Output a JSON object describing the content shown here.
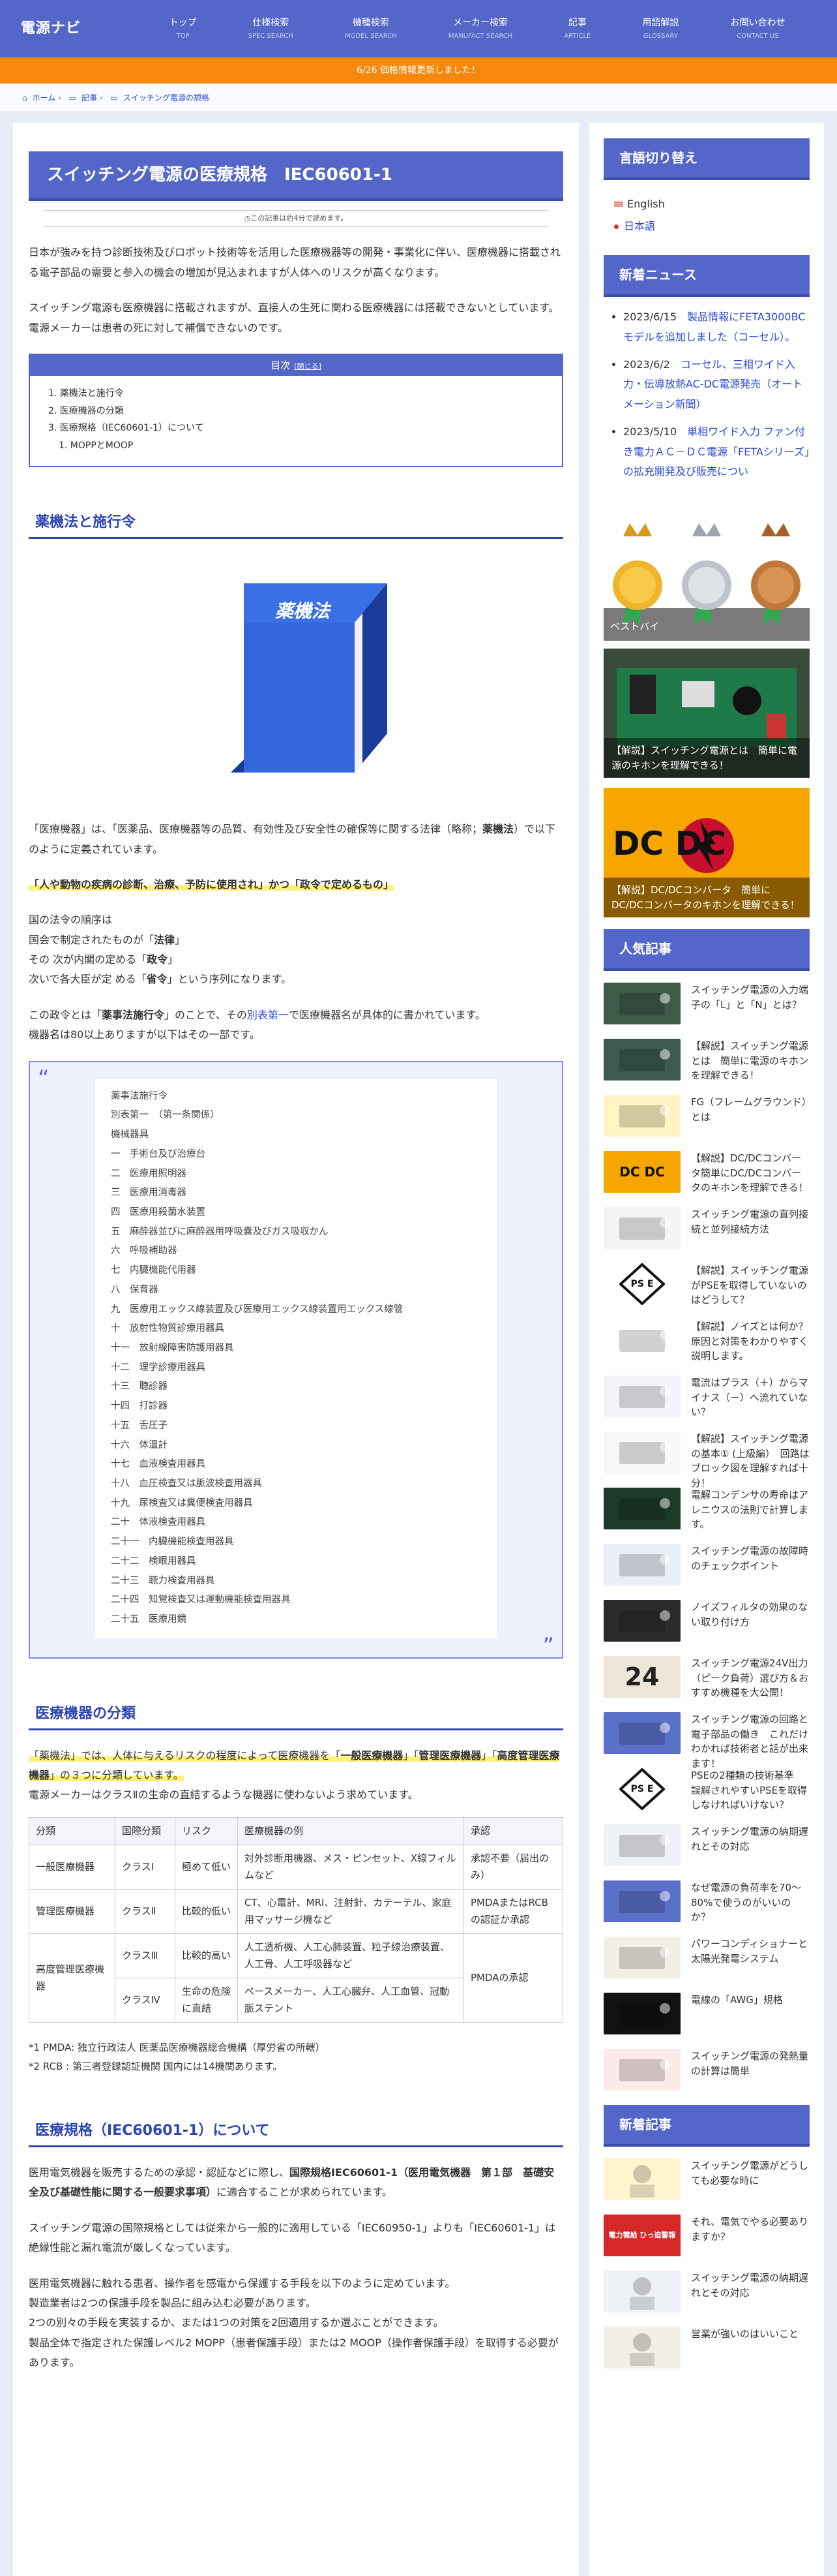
{
  "site": {
    "logo": "電源ナビ"
  },
  "nav": [
    {
      "ja": "トップ",
      "en": "TOP"
    },
    {
      "ja": "仕様検索",
      "en": "SPEC SEARCH"
    },
    {
      "ja": "機種検索",
      "en": "MODEL SEARCH"
    },
    {
      "ja": "メーカー検索",
      "en": "MANUFACT SEARCH"
    },
    {
      "ja": "記事",
      "en": "ARTICLE"
    },
    {
      "ja": "用語解説",
      "en": "GLOSSARY"
    },
    {
      "ja": "お問い合わせ",
      "en": "CONTACT US"
    }
  ],
  "notice": "6/26 価格情報更新しました！",
  "breadcrumb": [
    "ホーム",
    "記事",
    "スイッチング電源の規格"
  ],
  "article": {
    "title": "スイッチング電源の医療規格　IEC60601-1",
    "readtime": "この記事は約4分で読めます。",
    "intro1": "日本が強みを持つ診断技術及びロボット技術等を活用した医療機器等の開発・事業化に伴い、医療機器に搭載される電子部品の需要と参入の機会の増加が見込まれますが人体へのリスクが高くなります。",
    "intro2": "スイッチング電源も医療機器に搭載されますが、直接人の生死に関わる医療機器には搭載できないとしています。電源メーカーは患者の死に対して補償できないのです。",
    "toc": {
      "title": "目次",
      "toggle": "[閉じる]",
      "items": [
        "1. 薬機法と施行令",
        "2. 医療機器の分類",
        "3. 医療規格（IEC60601-1）について"
      ],
      "sub": "1. MOPPとMOOP"
    },
    "h2_1": "薬機法と施行令",
    "book_label": "薬機法",
    "p_def_a": "「医療機器」は、「医薬品、医療機器等の品質、有効性及び安全性の確保等に関する法律（略称；",
    "p_def_b": "薬機法",
    "p_def_c": "）で以下のように定義されています。",
    "p_hl": "「人や動物の疾病の診断、治療、予防に使用され」かつ「政令で定めるもの」",
    "order_0": "国の法令の順序は",
    "order_1a": "国会で制定されたものが「",
    "order_1b": "法律",
    "order_1c": "」",
    "order_2a": "その 次が内閣の定める「",
    "order_2b": "政令",
    "order_2c": "」",
    "order_3a": "次いで各大臣が定 める「",
    "order_3b": "省令",
    "order_3c": "」という序列になります。",
    "p_cab_a": "この政令とは「",
    "p_cab_b": "薬事法施行令",
    "p_cab_c": "」のことで、その",
    "p_cab_link": "別表第一",
    "p_cab_d": "で医療機器名が具体的に書かれています。",
    "p_cab_e": "機器名は80以上ありますが以下はその一部です。",
    "quote": [
      "薬事法施行令",
      "別表第一　（第一条関係）",
      "機械器具",
      "一　手術台及び治療台",
      "二　医療用照明器",
      "三　医療用消毒器",
      "四　医療用殺菌水装置",
      "五　麻酔器並びに麻酔器用呼吸嚢及びガス吸収かん",
      "六　呼吸補助器",
      "七　内臓機能代用器",
      "八　保育器",
      "九　医療用エックス線装置及び医療用エックス線装置用エックス線管",
      "十　放射性物質診療用器具",
      "十一　放射線障害防護用器具",
      "十二　理学診療用器具",
      "十三　聴診器",
      "十四　打診器",
      "十五　舌圧子",
      "十六　体温計",
      "十七　血液検査用器具",
      "十八　血圧検査又は脈波検査用器具",
      "十九　尿検査又は糞便検査用器具",
      "二十　体液検査用器具",
      "二十一　内臓機能検査用器具",
      "二十二　検眼用器具",
      "二十三　聴力検査用器具",
      "二十四　知覚検査又は運動機能検査用器具",
      "二十五　医療用鏡"
    ],
    "h2_2": "医療機器の分類",
    "cls_a": "「薬機法」では、人体に与えるリスクの程度によって医療機器を「",
    "cls_b": "一般医療機器",
    "cls_c": "」「",
    "cls_d": "管理医療機器",
    "cls_e": "」「",
    "cls_f": "高度管理医療機器",
    "cls_g": "」の３つに分類しています。",
    "cls_2": "電源メーカーはクラスⅡの生命の直結するような機器に使わないよう求めています。",
    "table": {
      "headers": [
        "分類",
        "国際分類",
        "リスク",
        "医療機器の例",
        "承認"
      ],
      "r1": [
        "一般医療機器",
        "クラスⅠ",
        "極めて低い",
        "対外診断用機器、メス・ピンセット、X線フィルムなど",
        "承認不要（届出のみ）"
      ],
      "r2": [
        "管理医療機器",
        "クラスⅡ",
        "比較的低い",
        "CT、心電計、MRI、注射針、カテーテル、家庭用マッサージ機など",
        "PMDAまたはRCBの認証か承認"
      ],
      "r3a": [
        "高度管理医療機器",
        "クラスⅢ",
        "比較的高い",
        "人工透析機、人工心肺装置、粒子線治療装置、人工骨、人工呼吸器など",
        "PMDAの承認"
      ],
      "r3b": [
        "クラスⅣ",
        "生命の危険に直結",
        "ペースメーカー、人工心臓弁、人工血管、冠動脈ステント"
      ]
    },
    "note1": "*1 PMDA: 独立行政法人 医薬品医療機器総合機構（厚労省の所轄）",
    "note2": "*2 RCB : 第三者登録認証機関 国内には14機関あります。",
    "h2_3": "医療規格（IEC60601-1）について",
    "iec_a": "医用電気機器を販売するための承認・認証などに際し、",
    "iec_b": "国際規格IEC60601-1（医用電気機器　第１部　基礎安全及び基礎性能に関する一般要求事項）",
    "iec_c": "に適合することが求められています。",
    "iec_2": "スイッチング電源の国際規格としては従来から一般的に適用している「IEC60950-1」よりも「IEC60601-1」は絶縁性能と漏れ電流が厳しくなっています。",
    "iec_3": [
      "医用電気機器に触れる患者、操作者を感電から保護する手段を以下のように定めています。",
      "製造業者は2つの保護手段を製品に組み込む必要があります。",
      "2つの別々の手段を実装するか、または1つの対策を2回適用するか選ぶことができます。",
      "製品全体で指定された保護レベル2 MOPP（患者保護手段）または2 MOOP（操作者保護手段）を取得する必要があります。"
    ]
  },
  "sidebar": {
    "lang_title": "言語切り替え",
    "langs": [
      "English",
      "日本語"
    ],
    "news_title": "新着ニュース",
    "news": [
      {
        "date": "2023/6/15",
        "text": "製品情報にFETA3000BCモデルを追加しました（コーセル）。"
      },
      {
        "date": "2023/6/2",
        "text": "コーセル、三相ワイド入力・伝導放熱AC-DC電源発売（オートメーション新聞）"
      },
      {
        "date": "2023/5/10",
        "text": "単相ワイド入力 ファン付き電力ＡＣ－ＤＣ電源「FETAシリーズ」の拡充開発及び販売につい"
      }
    ],
    "medals_caption": "ベストバイ",
    "card1": "【解説】スイッチング電源とは　簡単に電源のキホンを理解できる！",
    "card2_logo": "DC DC",
    "card2": "【解説】DC/DCコンバータ　簡単にDC/DCコンバータのキホンを理解できる！",
    "popular_title": "人気記事",
    "popular": [
      "スイッチング電源の入力端子の「L」と「N」とは？",
      "【解説】スイッチング電源とは　簡単に電源のキホンを理解できる！",
      "FG（フレームグラウンド）とは",
      "【解説】DC/DCコンバータ簡単にDC/DCコンバータのキホンを理解できる！",
      "スイッチング電源の直列接続と並列接続方法",
      "【解説】スイッチング電源がPSEを取得していないのはどうして？",
      "【解説】ノイズとは何か？原因と対策をわかりやすく説明します。",
      "電流はプラス（＋）からマイナス（－）へ流れていない？",
      "【解説】スイッチング電源の基本① (上級編）　回路はブロック図を理解すれば十分！",
      "電解コンデンサの寿命はアレニウスの法則で計算します。",
      "スイッチング電源の故障時のチェックポイント",
      "ノイズフィルタの効果のない取り付け方",
      "スイッチング電源24V出力（ピーク負荷）選び方＆おすすめ機種を大公開！",
      "スイッチング電源の回路と電子部品の働き　これだけわかれば技術者と話が出来ます！",
      "PSEの2種類の技術基準　誤解されやすいPSEを取得しなければいけない？",
      "スイッチング電源の納期遅れとその対応",
      "なぜ電源の負荷率を70～80%で使うのがいいのか？",
      "パワーコンディショナーと太陽光発電システム",
      "電線の「AWG」規格",
      "スイッチング電源の発熱量の計算は簡単"
    ],
    "pop_thumb_24": "24",
    "pop_thumb_pse": "PS E",
    "pop_thumb_dc": "DC DC",
    "new_title": "新着記事",
    "new_items": [
      "スイッチング電源がどうしても必要な時に",
      "それ、電気でやる必要ありますか？",
      "スイッチング電源の納期遅れとその対応",
      "営業が強いのはいいこと"
    ],
    "new_thumb_tag": "電力需給 ひっ迫警報"
  }
}
